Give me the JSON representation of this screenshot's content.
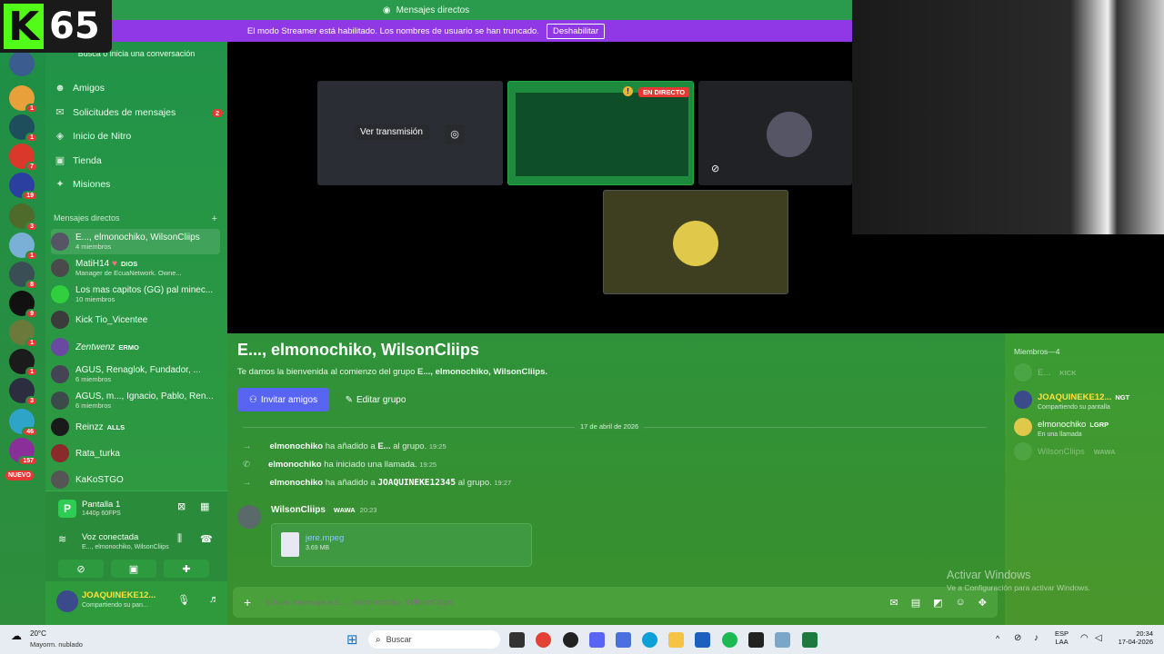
{
  "overlay": {
    "viewer_count": "65"
  },
  "titlebar": {
    "title": "Mensajes directos"
  },
  "streamer_bar": {
    "message": "El modo Streamer está habilitado. Los nombres de usuario se han truncado.",
    "button": "Deshabilitar"
  },
  "sidebar": {
    "search_placeholder": "Busca o inicia una conversación",
    "nav": [
      {
        "label": "Amigos"
      },
      {
        "label": "Solicitudes de mensajes",
        "count": "2"
      },
      {
        "label": "Inicio de Nitro"
      },
      {
        "label": "Tienda"
      },
      {
        "label": "Misiones"
      }
    ],
    "dm_header": "Mensajes directos",
    "dms": [
      {
        "name": "E..., elmonochiko, WilsonCliips",
        "sub": "4 miembros"
      },
      {
        "name": "MatiH14",
        "tag": "DIOS",
        "sub": "Manager de EcuaNetwork. Owne..."
      },
      {
        "name": "Los mas capitos (GG) pal minec...",
        "sub": "10 miembros"
      },
      {
        "name": "Kick Tio_Vicentee",
        "sub": ""
      },
      {
        "name": "Zentwenz",
        "tag": "ERMO",
        "sub": ""
      },
      {
        "name": "AGUS, Renaglok, Fundador, ...",
        "sub": "6 miembros"
      },
      {
        "name": "AGUS, m..., Ignacio, Pablo, Ren...",
        "sub": "6 miembros"
      },
      {
        "name": "Reinzz",
        "tag": "ALLS",
        "sub": ""
      },
      {
        "name": "Rata_turka",
        "sub": ""
      },
      {
        "name": "KaKoSTGO",
        "sub": ""
      }
    ],
    "server_badges": [
      "1",
      "1",
      "7",
      "19",
      "3",
      "1",
      "8",
      "9",
      "1",
      "1",
      "3",
      "46",
      "157"
    ],
    "new_label": "NUEVO",
    "screen_share": {
      "title": "Pantalla 1",
      "sub": "1440p 60FPS"
    },
    "voice": {
      "title": "Voz conectada",
      "sub": "E..., elmonochiko, WilsonCliips"
    },
    "user": {
      "name": "JOAQUINEKE12...",
      "status": "Compartiendo su pan..."
    }
  },
  "stage": {
    "watch_label": "Ver transmisión",
    "live_label": "EN DIRECTO"
  },
  "chat": {
    "title": "E..., elmonochiko, WilsonCliips",
    "welcome_prefix": "Te damos la bienvenida al comienzo del grupo ",
    "welcome_group": "E..., elmonochiko, WilsonCliips.",
    "invite_button": "Invitar amigos",
    "edit_button": "Editar grupo",
    "date_divider": "17 de abril de 2026",
    "system": [
      {
        "actor": "elmonochiko",
        "action": "ha añadido a",
        "target": "E...",
        "suffix": "al grupo.",
        "time": "19:25"
      },
      {
        "actor": "elmonochiko",
        "action": "ha iniciado una llamada.",
        "target": "",
        "suffix": "",
        "time": "19:25"
      },
      {
        "actor": "elmonochiko",
        "action": "ha añadido a",
        "target": "JOAQUINEKE12345",
        "suffix": "al grupo.",
        "time": "19:27"
      }
    ],
    "message": {
      "author": "WilsonCliips",
      "tag": "WAWA",
      "time": "20:23",
      "file_name": "jere.mpeg",
      "file_size": "3.69 MB"
    },
    "composer_placeholder": "Enviar mensaje a E..., elmonochiko, WilsonCliips"
  },
  "members": {
    "header": "Miembros—4",
    "list": [
      {
        "name": "E...",
        "tag": "KICK",
        "sub": ""
      },
      {
        "name": "JOAQUINEKE12...",
        "tag": "NGT",
        "sub": "Compartiendo su pantalla"
      },
      {
        "name": "elmonochiko",
        "tag": "LGRP",
        "sub": "En una llamada"
      },
      {
        "name": "WilsonCliips",
        "tag": "WAWA",
        "sub": ""
      }
    ]
  },
  "watermark": {
    "title": "Activar Windows",
    "sub": "Ve a Configuración para activar Windows."
  },
  "taskbar": {
    "weather_temp": "20°C",
    "weather_desc": "Mayorm. nublado",
    "search": "Buscar",
    "lang": "ESP",
    "lang_sub": "LAA",
    "time": "20:34",
    "date": "17-04-2026"
  },
  "colors": {
    "accent": "#5865f2",
    "streamer": "#9037e6",
    "live": "#e53935",
    "kick": "#53fc18"
  }
}
